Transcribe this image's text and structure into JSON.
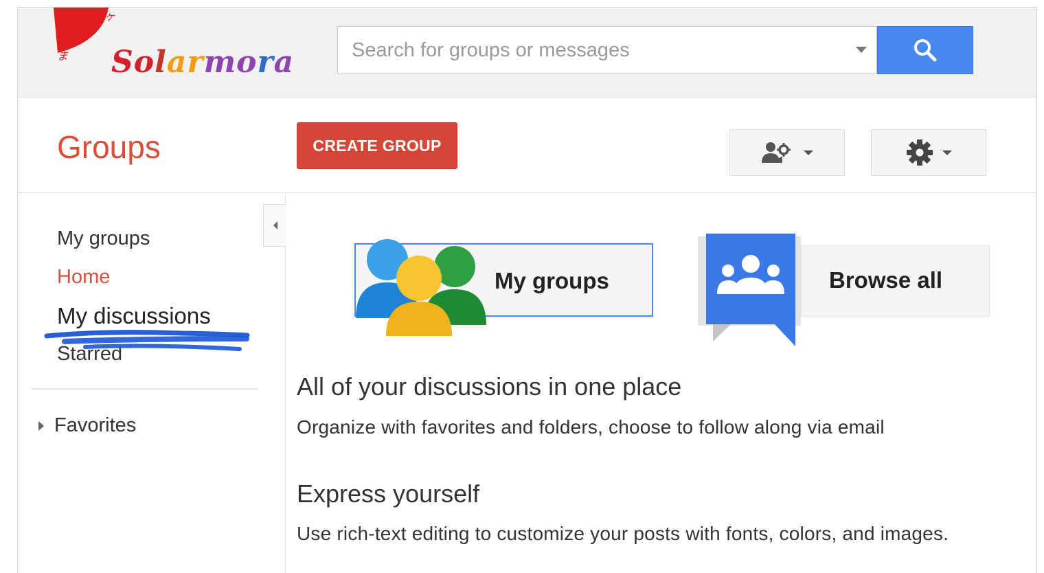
{
  "brand": {
    "logo_text": "Solarmora",
    "colors": {
      "red": "#dd4b39",
      "blue": "#4a87ee",
      "create_button": "#d44637"
    }
  },
  "search": {
    "placeholder": "Search for groups or messages",
    "button_icon": "search-icon",
    "dropdown_icon": "chevron-down-icon"
  },
  "toolbar": {
    "app_title": "Groups",
    "create_label": "CREATE GROUP",
    "people_settings_icon": "people-settings-icon",
    "settings_icon": "gear-icon"
  },
  "sidebar": {
    "collapse_icon": "chevron-left-icon",
    "items": [
      {
        "label": "My groups",
        "active": false
      },
      {
        "label": "Home",
        "active": true
      },
      {
        "label": "My discussions",
        "active": false,
        "highlighted": true
      },
      {
        "label": "Starred",
        "active": false
      }
    ],
    "favorites_label": "Favorites"
  },
  "cards": {
    "my_groups_label": "My groups",
    "browse_all_label": "Browse all"
  },
  "features": [
    {
      "title": "All of your discussions in one place",
      "description": "Organize with favorites and folders, choose to follow along via email"
    },
    {
      "title": "Express yourself",
      "description": "Use rich-text editing to customize your posts with fonts, colors, and images."
    }
  ]
}
